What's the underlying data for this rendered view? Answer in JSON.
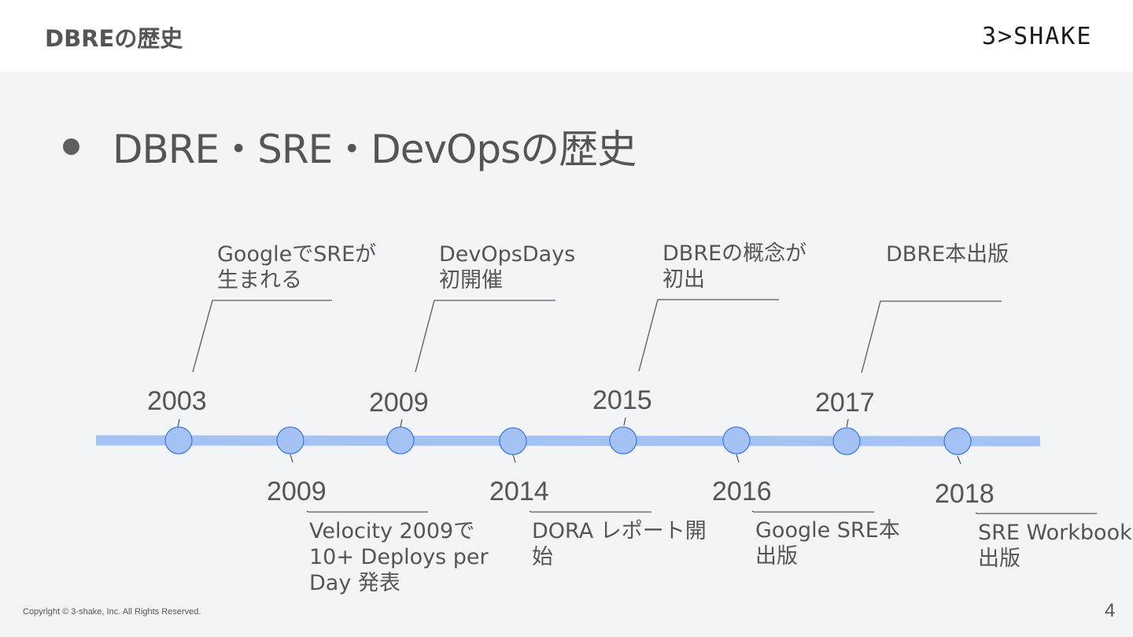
{
  "header": {
    "title": "DBREの歴史",
    "logo_text": "3>SHAKE"
  },
  "bullet": "DBRE・SRE・DevOpsの歴史",
  "timeline": {
    "top": [
      {
        "year": "2003",
        "label_lines": [
          "GoogleでSREが",
          "生まれる"
        ]
      },
      {
        "year": "2009",
        "label_lines": [
          "DevOpsDays",
          "初開催"
        ]
      },
      {
        "year": "2015",
        "label_lines": [
          "DBREの概念が",
          "初出"
        ]
      },
      {
        "year": "2017",
        "label_lines": [
          "DBRE本出版"
        ]
      }
    ],
    "bottom": [
      {
        "year": "2009",
        "label_lines": [
          "Velocity 2009で",
          "10+ Deploys per",
          "Day 発表"
        ]
      },
      {
        "year": "2014",
        "label_lines": [
          "DORA レポート開",
          "始"
        ]
      },
      {
        "year": "2016",
        "label_lines": [
          "Google SRE本",
          "出版"
        ]
      },
      {
        "year": "2018",
        "label_lines": [
          "SRE Workbook",
          "出版"
        ]
      }
    ],
    "colors": {
      "line": "#a4c2f4",
      "node": "#a4c2f4",
      "node_stroke": "#3c78d8",
      "leader": "#595959"
    }
  },
  "footer": {
    "copyright": "Copyright © 3-shake, Inc. All Rights Reserved.",
    "page": "4"
  }
}
